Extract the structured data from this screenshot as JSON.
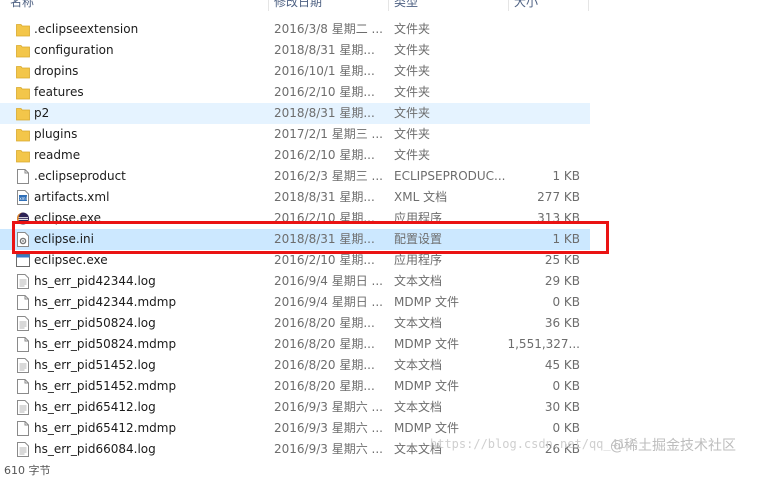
{
  "header": {
    "name_label": "名称",
    "date_label": "修改日期",
    "type_label": "类型",
    "size_label": "大小"
  },
  "files": [
    {
      "name": ".eclipseextension",
      "date": "2016/3/8 星期二 ...",
      "type": "文件夹",
      "size": "",
      "icon": "folder-icon",
      "state": ""
    },
    {
      "name": "configuration",
      "date": "2018/8/31 星期...",
      "type": "文件夹",
      "size": "",
      "icon": "folder-icon",
      "state": ""
    },
    {
      "name": "dropins",
      "date": "2016/10/1 星期...",
      "type": "文件夹",
      "size": "",
      "icon": "folder-icon",
      "state": ""
    },
    {
      "name": "features",
      "date": "2016/2/10 星期...",
      "type": "文件夹",
      "size": "",
      "icon": "folder-icon",
      "state": ""
    },
    {
      "name": "p2",
      "date": "2018/8/31 星期...",
      "type": "文件夹",
      "size": "",
      "icon": "folder-icon",
      "state": "hover"
    },
    {
      "name": "plugins",
      "date": "2017/2/1 星期三 ...",
      "type": "文件夹",
      "size": "",
      "icon": "folder-icon",
      "state": ""
    },
    {
      "name": "readme",
      "date": "2016/2/10 星期...",
      "type": "文件夹",
      "size": "",
      "icon": "folder-icon",
      "state": ""
    },
    {
      "name": ".eclipseproduct",
      "date": "2016/2/3 星期三 ...",
      "type": "ECLIPSEPRODUC...",
      "size": "1 KB",
      "icon": "document-icon",
      "state": ""
    },
    {
      "name": "artifacts.xml",
      "date": "2018/8/31 星期...",
      "type": "XML 文档",
      "size": "277 KB",
      "icon": "xml-file-icon",
      "state": ""
    },
    {
      "name": "eclipse.exe",
      "date": "2016/2/10 星期...",
      "type": "应用程序",
      "size": "313 KB",
      "icon": "eclipse-app-icon",
      "state": ""
    },
    {
      "name": "eclipse.ini",
      "date": "2018/8/31 星期...",
      "type": "配置设置",
      "size": "1 KB",
      "icon": "ini-file-icon",
      "state": "selected"
    },
    {
      "name": "eclipsec.exe",
      "date": "2016/2/10 星期...",
      "type": "应用程序",
      "size": "25 KB",
      "icon": "exe-app-icon",
      "state": ""
    },
    {
      "name": "hs_err_pid42344.log",
      "date": "2016/9/4 星期日 ...",
      "type": "文本文档",
      "size": "29 KB",
      "icon": "text-file-icon",
      "state": ""
    },
    {
      "name": "hs_err_pid42344.mdmp",
      "date": "2016/9/4 星期日 ...",
      "type": "MDMP 文件",
      "size": "0 KB",
      "icon": "document-icon",
      "state": ""
    },
    {
      "name": "hs_err_pid50824.log",
      "date": "2016/8/20 星期...",
      "type": "文本文档",
      "size": "36 KB",
      "icon": "text-file-icon",
      "state": ""
    },
    {
      "name": "hs_err_pid50824.mdmp",
      "date": "2016/8/20 星期...",
      "type": "MDMP 文件",
      "size": "1,551,327...",
      "icon": "document-icon",
      "state": ""
    },
    {
      "name": "hs_err_pid51452.log",
      "date": "2016/8/20 星期...",
      "type": "文本文档",
      "size": "45 KB",
      "icon": "text-file-icon",
      "state": ""
    },
    {
      "name": "hs_err_pid51452.mdmp",
      "date": "2016/8/20 星期...",
      "type": "MDMP 文件",
      "size": "0 KB",
      "icon": "document-icon",
      "state": ""
    },
    {
      "name": "hs_err_pid65412.log",
      "date": "2016/9/3 星期六 ...",
      "type": "文本文档",
      "size": "30 KB",
      "icon": "text-file-icon",
      "state": ""
    },
    {
      "name": "hs_err_pid65412.mdmp",
      "date": "2016/9/3 星期六 ...",
      "type": "MDMP 文件",
      "size": "0 KB",
      "icon": "document-icon",
      "state": ""
    },
    {
      "name": "hs_err_pid66084.log",
      "date": "2016/9/3 星期六 ...",
      "type": "文本文档",
      "size": "26 KB",
      "icon": "text-file-icon",
      "state": ""
    }
  ],
  "status_text": "610 字节",
  "watermark": {
    "url": "https://blog.csdn.net/qq_41...",
    "brand": "@稀土掘金技术社区"
  },
  "colors": {
    "folder": "#f3c64a",
    "selection": "#cce8ff",
    "hover": "#e5f3ff",
    "highlight_box": "#ea1313"
  }
}
